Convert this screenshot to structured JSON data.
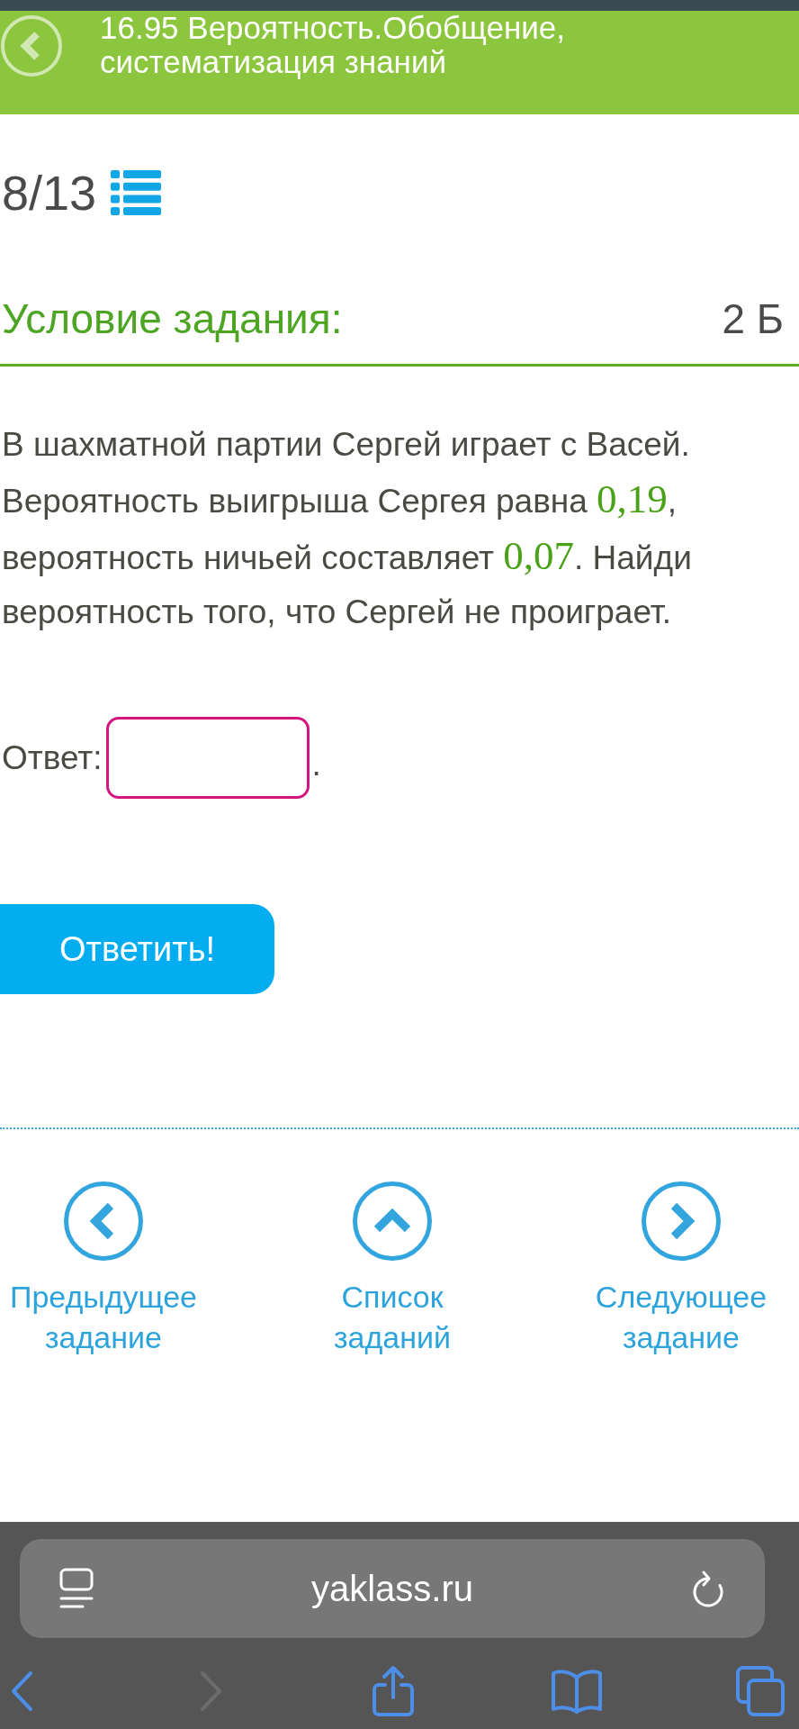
{
  "header": {
    "title": "16.95 Вероятность.Обобщение, систематизация знаний"
  },
  "progress": {
    "counter": "8/13"
  },
  "task": {
    "heading": "Условие задания:",
    "points": "2 Б",
    "parts": [
      {
        "kind": "text",
        "text": "В шахматной партии Сергей играет с Васей. Вероятность выигрыша Сергея равна "
      },
      {
        "kind": "math",
        "text": "0,19"
      },
      {
        "kind": "text",
        "text": ", вероятность ничьей составляет "
      },
      {
        "kind": "math",
        "text": "0,07"
      },
      {
        "kind": "text",
        "text": ". Найди вероятность того, что Сергей не проиграет."
      }
    ]
  },
  "answer": {
    "label": "Ответ:",
    "suffix": "."
  },
  "submit_button": {
    "label": "Ответить!"
  },
  "navigation": [
    {
      "kind": "previous",
      "label": "Предыдущее задание"
    },
    {
      "kind": "list",
      "label": "Список заданий"
    },
    {
      "kind": "next",
      "label": "Следующее задание"
    }
  ],
  "browser": {
    "url": "yaklass.ru",
    "toolbar": [
      {
        "kind": "back",
        "disabled": false
      },
      {
        "kind": "forward",
        "disabled": true
      },
      {
        "kind": "share",
        "disabled": false
      },
      {
        "kind": "bookmarks",
        "disabled": false
      },
      {
        "kind": "tabs",
        "disabled": false
      }
    ]
  }
}
